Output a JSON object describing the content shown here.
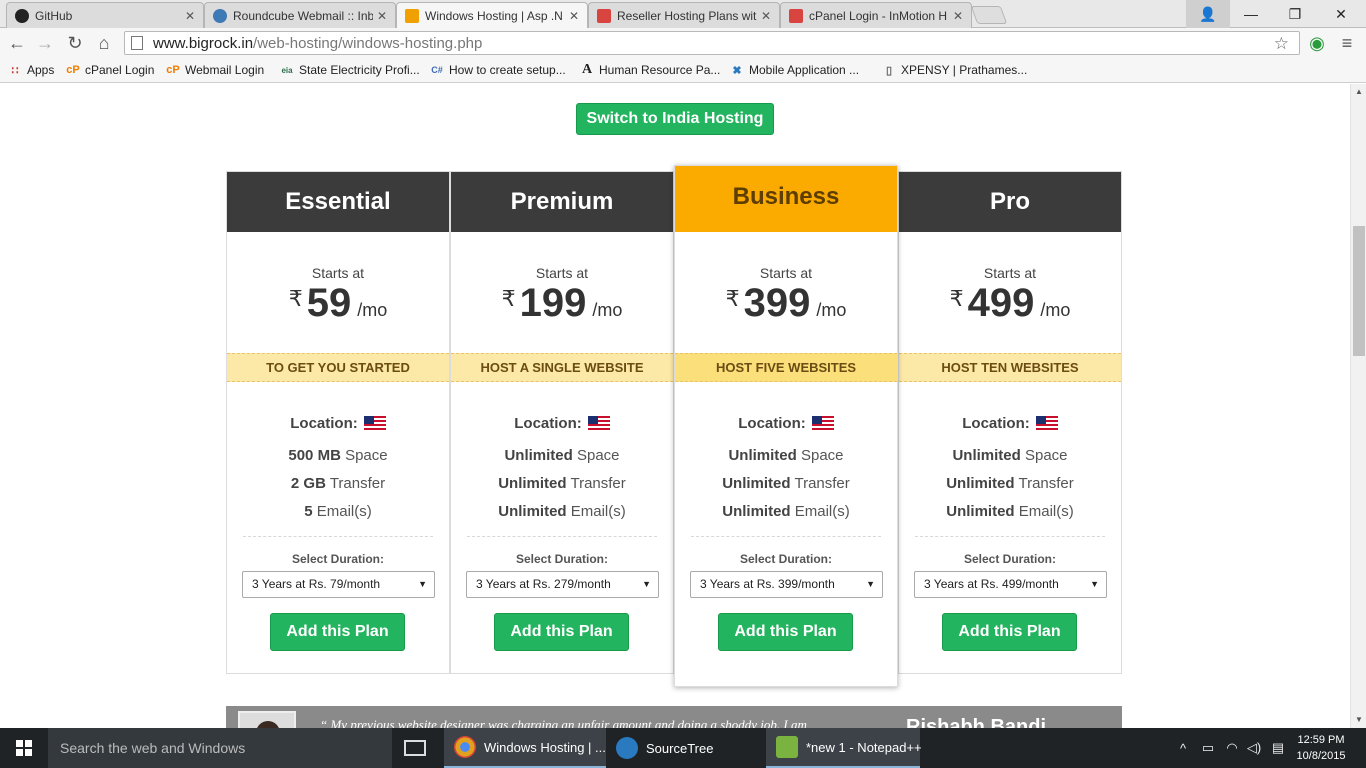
{
  "browser": {
    "tabs": [
      {
        "label": "GitHub",
        "color": "#222222"
      },
      {
        "label": "Roundcube Webmail :: Inb",
        "color": "#3d7ab6"
      },
      {
        "label": "Windows Hosting | Asp .N",
        "color": "#f0a000"
      },
      {
        "label": "Reseller Hosting Plans wit",
        "color": "#d9443f"
      },
      {
        "label": "cPanel Login - InMotion H",
        "color": "#d9443f"
      }
    ],
    "url_host": "www.bigrock.in",
    "url_path": "/web-hosting/windows-hosting.php",
    "bookmarks": [
      {
        "label": "Apps",
        "icon": "apps-grid-icon",
        "glyph": "∷"
      },
      {
        "label": "cPanel Login",
        "icon": "cpanel-icon",
        "glyph": "cP"
      },
      {
        "label": "Webmail Login",
        "icon": "cpanel-icon",
        "glyph": "cP"
      },
      {
        "label": "State Electricity Profi...",
        "icon": "eia-icon",
        "glyph": "eia"
      },
      {
        "label": "How to create setup...",
        "icon": "csharp-icon",
        "glyph": "C#"
      },
      {
        "label": "Human Resource Pa...",
        "icon": "font-icon",
        "glyph": "A"
      },
      {
        "label": "Mobile Application ...",
        "icon": "x-circle-icon",
        "glyph": "✖"
      },
      {
        "label": "XPENSY | Prathames...",
        "icon": "page-icon",
        "glyph": "▯"
      }
    ]
  },
  "page": {
    "switch_label": "Switch to India Hosting",
    "starts_label": "Starts at",
    "currency": "₹",
    "per": "/mo",
    "location_label": "Location:",
    "duration_label": "Select Duration:",
    "add_label": "Add this Plan",
    "plans": [
      {
        "name": "Essential",
        "price": "59",
        "tagline": "TO GET YOU STARTED",
        "space_value": "500 MB",
        "space_label": "Space",
        "transfer_value": "2 GB",
        "transfer_label": "Transfer",
        "email_value": "5",
        "email_label": "Email(s)",
        "duration": "3 Years at Rs. 79/month"
      },
      {
        "name": "Premium",
        "price": "199",
        "tagline": "HOST A SINGLE WEBSITE",
        "space_value": "Unlimited",
        "space_label": "Space",
        "transfer_value": "Unlimited",
        "transfer_label": "Transfer",
        "email_value": "Unlimited",
        "email_label": "Email(s)",
        "duration": "3 Years at Rs. 279/month"
      },
      {
        "name": "Business",
        "price": "399",
        "tagline": "HOST FIVE WEBSITES",
        "space_value": "Unlimited",
        "space_label": "Space",
        "transfer_value": "Unlimited",
        "transfer_label": "Transfer",
        "email_value": "Unlimited",
        "email_label": "Email(s)",
        "duration": "3 Years at Rs. 399/month"
      },
      {
        "name": "Pro",
        "price": "499",
        "tagline": "HOST TEN WEBSITES",
        "space_value": "Unlimited",
        "space_label": "Space",
        "transfer_value": "Unlimited",
        "transfer_label": "Transfer",
        "email_value": "Unlimited",
        "email_label": "Email(s)",
        "duration": "3 Years at Rs. 499/month"
      }
    ],
    "testimonial_quote": "“  My previous website designer was charging an unfair amount and doing a shoddy job. I am",
    "testimonial_name": "Rishabh Bandi"
  },
  "taskbar": {
    "search_placeholder": "Search the web and Windows",
    "tasks": [
      {
        "label": "Windows Hosting | ...",
        "color": "#e0a020"
      },
      {
        "label": "SourceTree",
        "color": "#2a7ac0"
      },
      {
        "label": "*new 1 - Notepad++",
        "color": "#7bb341"
      }
    ],
    "time": "12:59 PM",
    "date": "10/8/2015"
  },
  "colors": {
    "accent_green": "#22b45f",
    "featured_orange": "#fbab00",
    "header_dark": "#3b3b3b"
  }
}
